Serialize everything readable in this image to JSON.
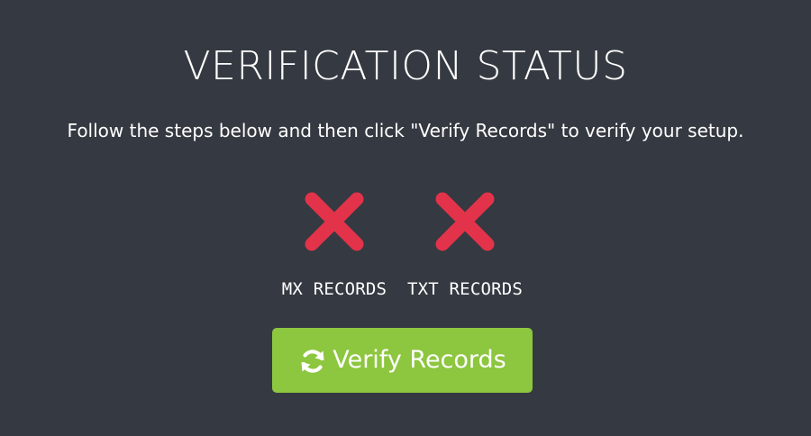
{
  "header": {
    "title": "VERIFICATION STATUS",
    "instructions": "Follow the steps below and then click \"Verify Records\" to verify your setup."
  },
  "records": [
    {
      "label": "MX RECORDS",
      "status": "failed",
      "icon": "x-mark-icon"
    },
    {
      "label": "TXT RECORDS",
      "status": "failed",
      "icon": "x-mark-icon"
    }
  ],
  "actions": {
    "verify_label": "Verify Records",
    "verify_icon": "refresh-icon"
  },
  "colors": {
    "background": "#353941",
    "fail_red": "#e2334a",
    "button_green": "#8dc63f",
    "text": "#ffffff"
  }
}
